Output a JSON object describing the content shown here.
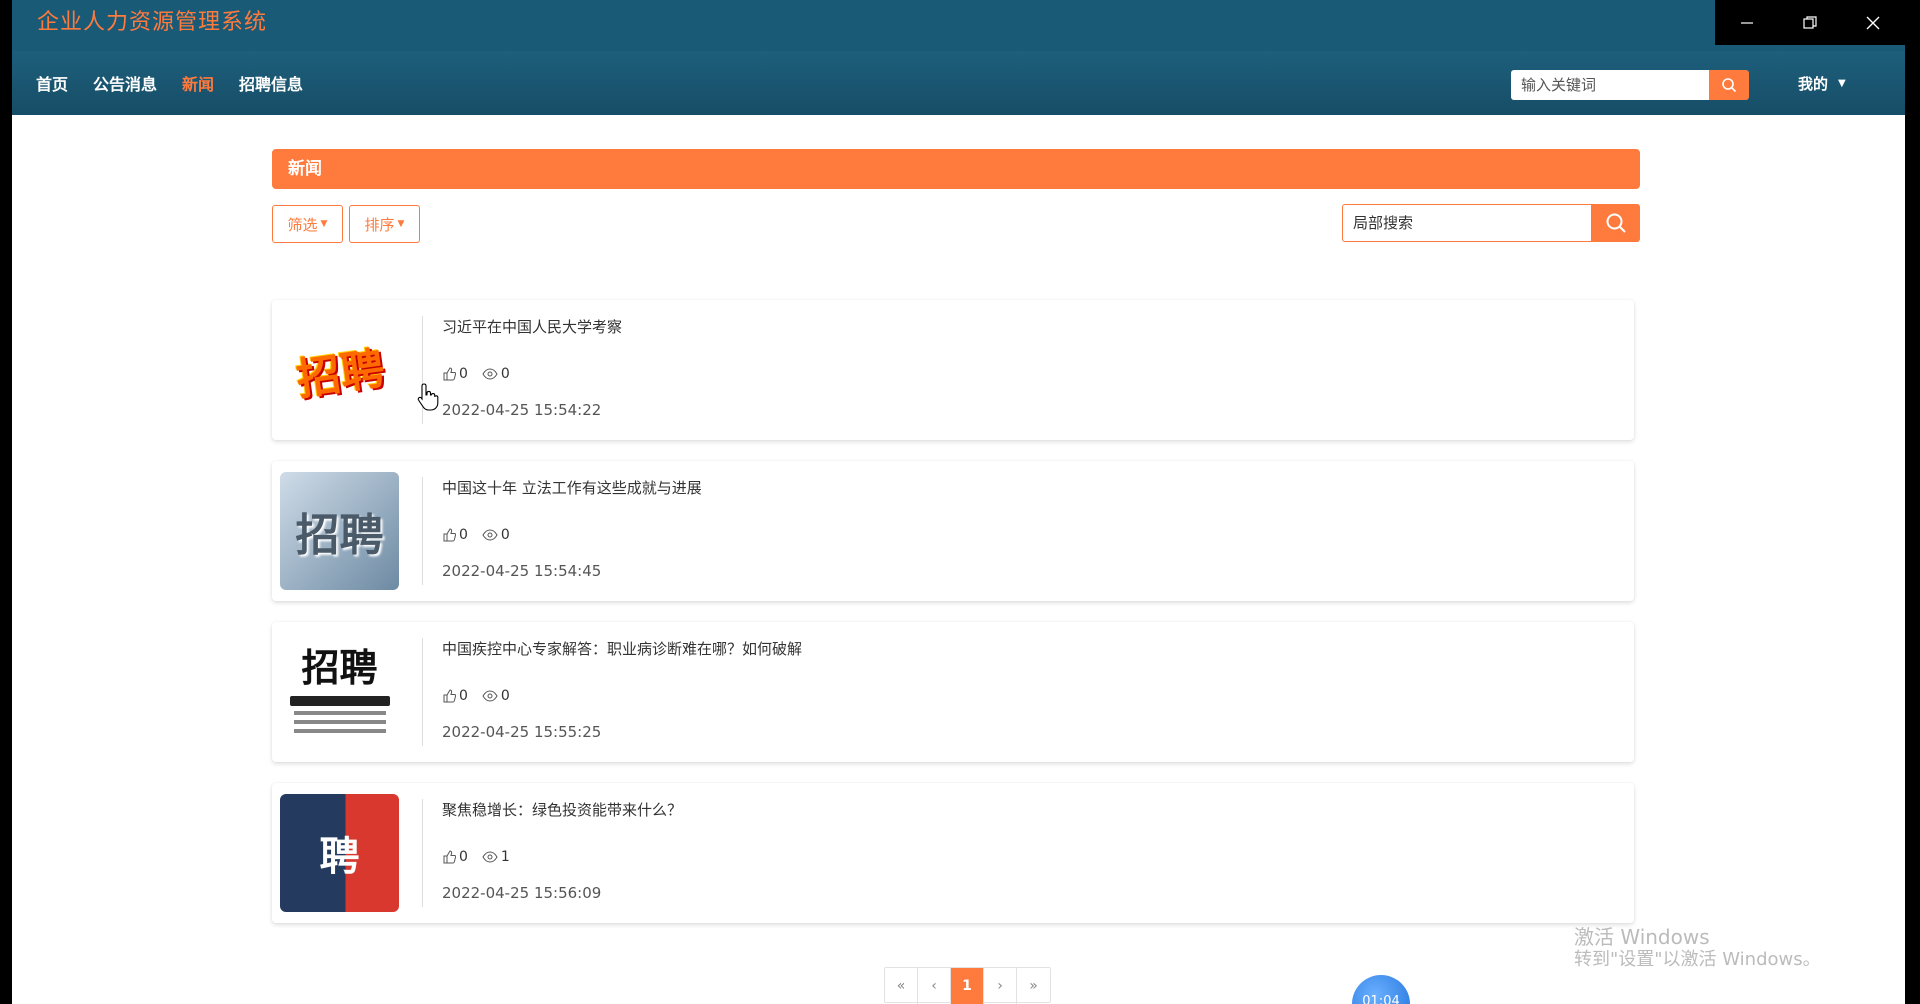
{
  "app": {
    "title": "企业人力资源管理系统"
  },
  "nav": {
    "links": [
      {
        "label": "首页",
        "active": false
      },
      {
        "label": "公告消息",
        "active": false
      },
      {
        "label": "新闻",
        "active": true
      },
      {
        "label": "招聘信息",
        "active": false
      }
    ],
    "search_placeholder": "输入关键词",
    "user_menu": "我的"
  },
  "page": {
    "section_title": "新闻",
    "filter_label": "筛选",
    "sort_label": "排序",
    "local_search_placeholder": "局部搜索"
  },
  "news": [
    {
      "title": "习近平在中国人民大学考察",
      "likes": "0",
      "views": "0",
      "time": "2022-04-25 15:54:22",
      "thumb_text": "招聘"
    },
    {
      "title": "中国这十年 立法工作有这些成就与进展",
      "likes": "0",
      "views": "0",
      "time": "2022-04-25 15:54:45",
      "thumb_text": "招聘"
    },
    {
      "title": "中国疾控中心专家解答：职业病诊断难在哪？如何破解",
      "likes": "0",
      "views": "0",
      "time": "2022-04-25 15:55:25",
      "thumb_text": "招聘"
    },
    {
      "title": "聚焦稳增长：绿色投资能带来什么？",
      "likes": "0",
      "views": "1",
      "time": "2022-04-25 15:56:09",
      "thumb_text": "聘"
    }
  ],
  "pagination": {
    "first": "«",
    "prev": "‹",
    "current": "1",
    "next": "›",
    "last": "»"
  },
  "overlay": {
    "watermark_line1": "激活 Windows",
    "watermark_line2": "转到\"设置\"以激活 Windows。",
    "timer": "01:04"
  },
  "colors": {
    "accent": "#ff7a3d",
    "header_bg": "#195a77"
  }
}
